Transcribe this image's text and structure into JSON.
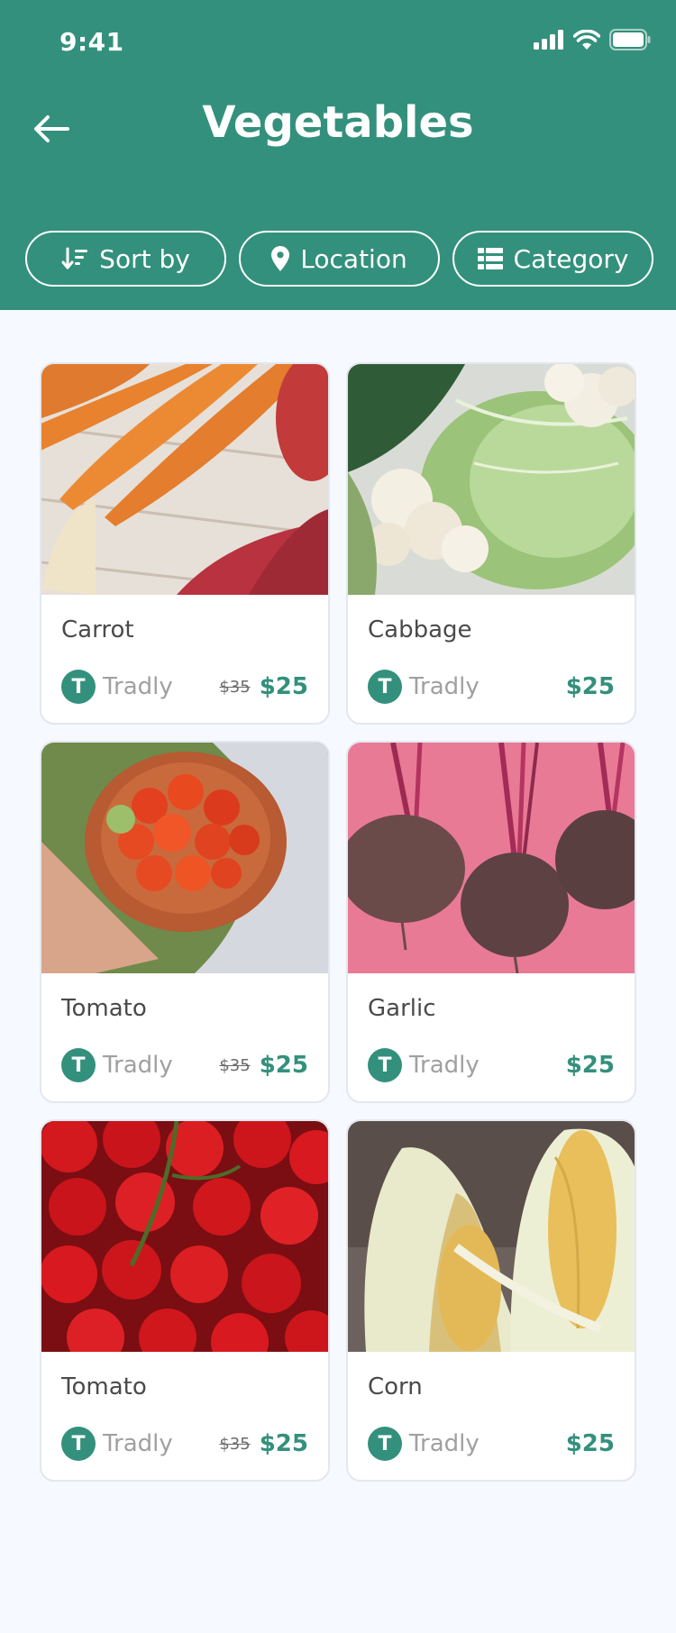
{
  "status": {
    "time": "9:41"
  },
  "header": {
    "title": "Vegetables"
  },
  "filters": {
    "sort_label": "Sort by",
    "location_label": "Location",
    "category_label": "Category"
  },
  "products": [
    {
      "name": "Carrot",
      "store": "Tradly",
      "store_initial": "T",
      "old_price": "$35",
      "price": "$25",
      "image": "carrot"
    },
    {
      "name": "Cabbage",
      "store": "Tradly",
      "store_initial": "T",
      "old_price": "",
      "price": "$25",
      "image": "cauliflower"
    },
    {
      "name": "Tomato",
      "store": "Tradly",
      "store_initial": "T",
      "old_price": "$35",
      "price": "$25",
      "image": "tomato-bowl"
    },
    {
      "name": "Garlic",
      "store": "Tradly",
      "store_initial": "T",
      "old_price": "",
      "price": "$25",
      "image": "beetroot"
    },
    {
      "name": "Tomato",
      "store": "Tradly",
      "store_initial": "T",
      "old_price": "$35",
      "price": "$25",
      "image": "tomatoes"
    },
    {
      "name": "Corn",
      "store": "Tradly",
      "store_initial": "T",
      "old_price": "",
      "price": "$25",
      "image": "corn"
    }
  ],
  "colors": {
    "primary": "#33907C",
    "background": "#F6F9FF",
    "text": "#4A4A4A",
    "muted": "#A0A0A0"
  }
}
